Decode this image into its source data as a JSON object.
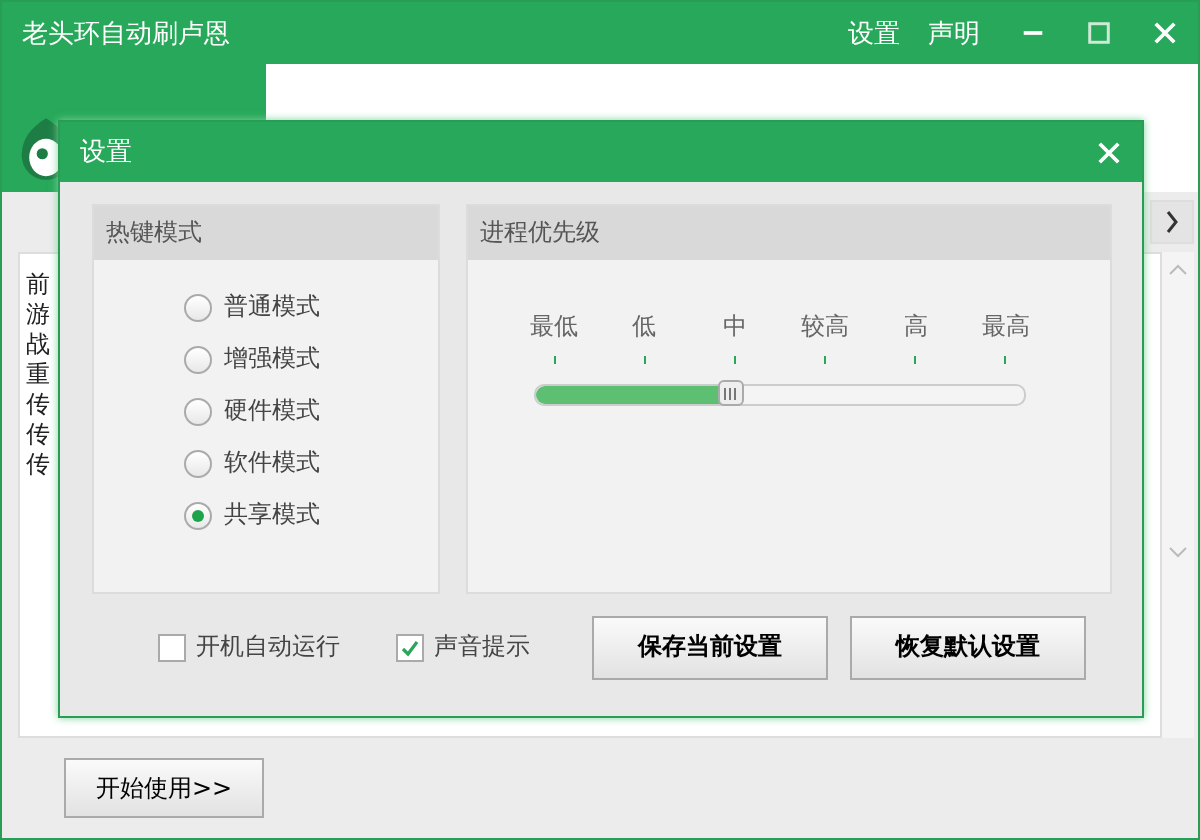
{
  "window": {
    "title": "老头环自动刷卢恩",
    "menu": [
      "设置",
      "声明"
    ]
  },
  "background_list": [
    "前",
    "游",
    "战",
    "重",
    "传",
    "传",
    "传"
  ],
  "start_button": "开始使用>>",
  "dialog": {
    "title": "设置",
    "hotkey_group": {
      "title": "热键模式",
      "options": [
        {
          "label": "普通模式",
          "selected": false
        },
        {
          "label": "增强模式",
          "selected": false
        },
        {
          "label": "硬件模式",
          "selected": false
        },
        {
          "label": "软件模式",
          "selected": false
        },
        {
          "label": "共享模式",
          "selected": true
        }
      ]
    },
    "priority_group": {
      "title": "进程优先级",
      "ticks": [
        "最低",
        "低",
        "中",
        "较高",
        "高",
        "最高"
      ],
      "level": 0.4
    },
    "checkboxes": [
      {
        "label": "开机自动运行",
        "checked": false
      },
      {
        "label": "声音提示",
        "checked": true
      }
    ],
    "buttons": [
      "保存当前设置",
      "恢复默认设置"
    ]
  }
}
